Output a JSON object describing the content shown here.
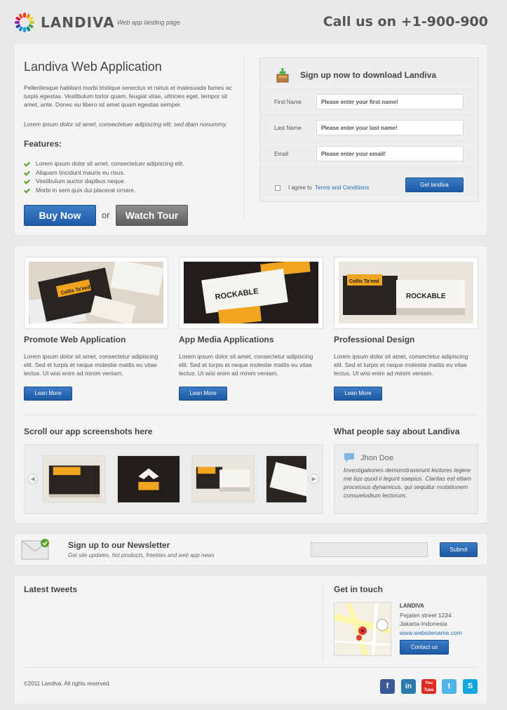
{
  "header": {
    "brand": "LANDIVA",
    "tagline": "Web app landing page",
    "call": "Call us on +1-900-900"
  },
  "hero": {
    "title": "Landiva Web Application",
    "intro": "Pellentesque habitant morbi tristique senectus et netus et malesuada fames ac turpis egestas. Vestibulum tortor quam, feugiat vitae, ultricies eget, tempor sit amet, ante. Donec eu libero sit amet quam egestas semper.",
    "italic_line": "Lorem ipsum dolor sit amet, consectetuer adipiscing elit, sed diam nonummy.",
    "features_heading": "Features:",
    "features": [
      "Lorem ipsum dolor sit amet, consectetuer adipiscing elit.",
      "Aliquam tincidunt mauris eu risus.",
      "Vestibulum auctor dapibus neque.",
      "Morbi in sem quis dui placerat ornare."
    ],
    "buy_label": "Buy Now",
    "or_label": "or",
    "tour_label": "Watch Tour"
  },
  "signup": {
    "heading": "Sign up now to download Landiva",
    "first_label": "First Name",
    "first_placeholder": "Please enter your first name!",
    "last_label": "Last Name",
    "last_placeholder": "Please enter your last name!",
    "email_label": "Email",
    "email_placeholder": "Please enter your email!",
    "agree_text": "I agree to",
    "terms_link": "Terms and Conditions",
    "submit_label": "Get landiva"
  },
  "features_cols": [
    {
      "title": "Promote Web Application",
      "text": "Lorem ipsum dolor sit amet, consectetur adipiscing elit. Sed et turpis et neque molestie mattis eu vitae lectus. Ut wisi enim ad minim veniam.",
      "button": "Lean More"
    },
    {
      "title": "App Media Applications",
      "text": "Lorem ipsum dolor sit amet, consectetur adipiscing elit. Sed et turpis et neque molestie mattis eu vitae lectus. Ut wisi enim ad minim veniam.",
      "button": "Lean More"
    },
    {
      "title": "Professional Design",
      "text": "Lorem ipsum dolor sit amet, consectetur adipiscing elit. Sed et turpis et neque molestie mattis eu vitae lectus. Ut wisi enim ad minim veniam.",
      "button": "Lean More"
    }
  ],
  "screenshots": {
    "heading": "Scroll our app screenshots here"
  },
  "testimonial": {
    "heading": "What people say about Landiva",
    "name": "Jhon Doe",
    "quote": "Investigationes demonstraverunt lectores legere me lius quod ii legunt saepius. Claritas est etiam processus dynamicus, qui sequitur mutationem consuetudium lectorum."
  },
  "newsletter": {
    "heading": "Sign up to our Newsletter",
    "sub": "Get site updates, hot products, freebies and web app news",
    "submit_label": "Submit"
  },
  "footer": {
    "tweets_heading": "Latest tweets",
    "contact_heading": "Get in touch",
    "company": "LANDIVA",
    "street": "Pejaten street 1234",
    "city": "Jakarta-Indonesia",
    "website": "www.websitename.com",
    "contact_button": "Contact us",
    "copyright": "©2011 Landiva. All rights reserved.",
    "social": [
      "facebook-icon",
      "linkedin-icon",
      "youtube-icon",
      "twitter-icon",
      "skype-icon"
    ]
  },
  "card_texts": {
    "rockable": "ROCKABLE",
    "collis": "Collis Ta'eed"
  }
}
